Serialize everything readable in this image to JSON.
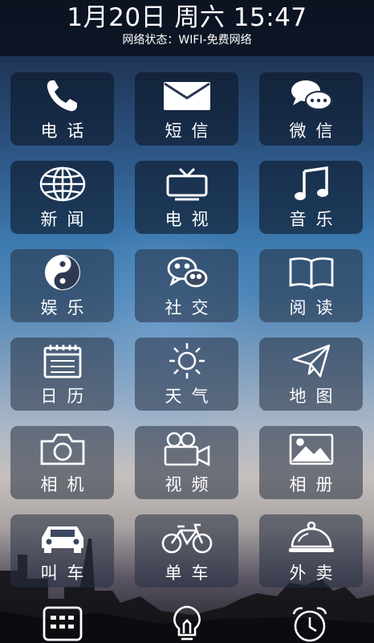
{
  "status": {
    "datetime": "1月20日 周六 15:47",
    "network": "网络状态：WIFI-免费网络"
  },
  "tiles": [
    {
      "label": "电话",
      "icon": "phone-icon"
    },
    {
      "label": "短信",
      "icon": "envelope-icon"
    },
    {
      "label": "微信",
      "icon": "chat-bubbles-icon"
    },
    {
      "label": "新闻",
      "icon": "globe-icon"
    },
    {
      "label": "电视",
      "icon": "tv-icon"
    },
    {
      "label": "音乐",
      "icon": "music-note-icon"
    },
    {
      "label": "娱乐",
      "icon": "yin-yang-icon"
    },
    {
      "label": "社交",
      "icon": "social-chat-icon"
    },
    {
      "label": "阅读",
      "icon": "open-book-icon"
    },
    {
      "label": "日历",
      "icon": "calendar-icon"
    },
    {
      "label": "天气",
      "icon": "sun-icon"
    },
    {
      "label": "地图",
      "icon": "paper-plane-icon"
    },
    {
      "label": "相机",
      "icon": "camera-icon"
    },
    {
      "label": "视频",
      "icon": "video-camera-icon"
    },
    {
      "label": "相册",
      "icon": "photo-album-icon"
    },
    {
      "label": "叫车",
      "icon": "car-icon"
    },
    {
      "label": "单车",
      "icon": "bicycle-icon"
    },
    {
      "label": "外卖",
      "icon": "food-cloche-icon"
    }
  ],
  "dock": [
    {
      "icon": "keypad-icon"
    },
    {
      "icon": "light-bulb-icon"
    },
    {
      "icon": "alarm-clock-icon"
    }
  ]
}
